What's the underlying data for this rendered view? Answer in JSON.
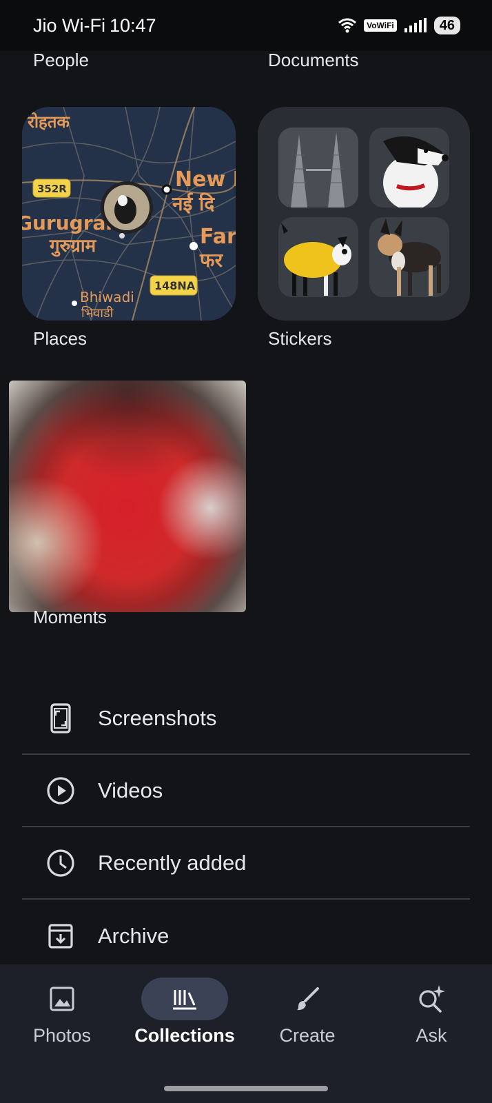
{
  "status": {
    "carrier": "Jio Wi-Fi",
    "time": "10:47",
    "vowifi": "VoWiFi",
    "battery": "46"
  },
  "sections": {
    "people": "People",
    "documents": "Documents",
    "places": "Places",
    "stickers": "Stickers",
    "moments": "Moments"
  },
  "map": {
    "labels": [
      "रोहतक",
      "352R",
      "Gurugram",
      "गुरुग्राम",
      "New D",
      "नई दि",
      "Far",
      "फर",
      "Bhiwadi",
      "भिवाडी",
      "148NA"
    ]
  },
  "list": [
    {
      "label": "Screenshots",
      "icon": "phone-screenshot-icon"
    },
    {
      "label": "Videos",
      "icon": "play-circle-icon"
    },
    {
      "label": "Recently added",
      "icon": "clock-icon"
    },
    {
      "label": "Archive",
      "icon": "archive-icon"
    }
  ],
  "nav": {
    "photos": "Photos",
    "collections": "Collections",
    "create": "Create",
    "ask": "Ask",
    "active": "collections"
  },
  "colors": {
    "background": "#121418",
    "nav_background": "#1d2028",
    "active_pill": "#3b4256"
  }
}
